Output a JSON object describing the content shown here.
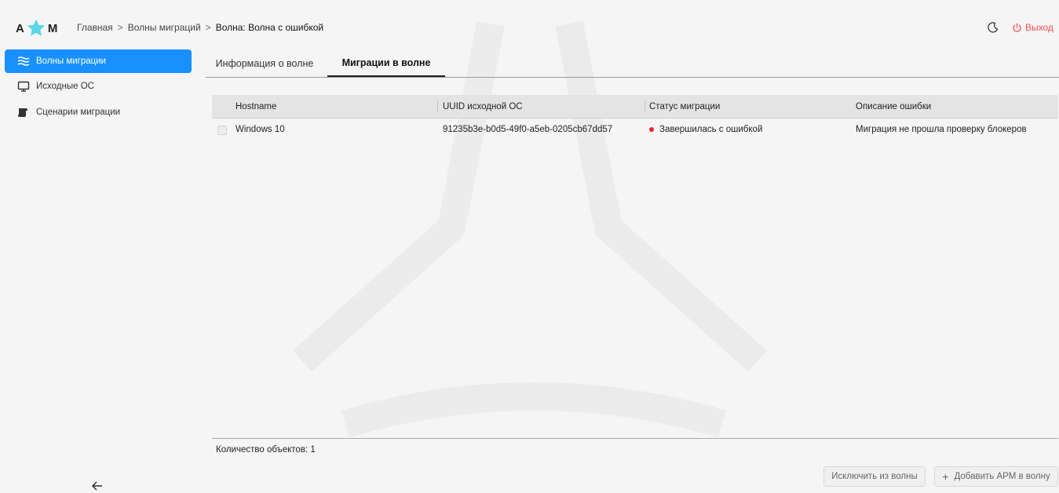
{
  "logo": {
    "left_letter": "A",
    "right_letter": "M",
    "star_color": "#5ad6e8"
  },
  "breadcrumb": [
    {
      "label": "Главная"
    },
    {
      "label": "Волны миграций"
    },
    {
      "label": "Волна: Волна с ошибкой"
    }
  ],
  "breadcrumb_separator": ">",
  "header": {
    "logout_label": "Выход",
    "logout_color": "#ff4d4f"
  },
  "sidebar": {
    "items": [
      {
        "label": "Волны миграции",
        "icon": "waves-icon",
        "active": true
      },
      {
        "label": "Исходные ОС",
        "icon": "monitor-icon",
        "active": false
      },
      {
        "label": "Сценарии миграции",
        "icon": "scroll-icon",
        "active": false
      }
    ],
    "accent": "#1890ff"
  },
  "tabs": [
    {
      "label": "Информация о волне",
      "active": false
    },
    {
      "label": "Миграции в волне",
      "active": true
    }
  ],
  "table": {
    "columns": [
      "Hostname",
      "UUID исходной ОС",
      "Статус миграции",
      "Описание ошибки"
    ],
    "rows": [
      {
        "hostname": "Windows 10",
        "uuid": "91235b3e-b0d5-49f0-a5eb-0205cb67dd57",
        "status": "Завершилась с ошибкой",
        "status_color": "#f5222d",
        "error": "Миграция не прошла проверку блокеров"
      }
    ]
  },
  "footer": {
    "count_label": "Количество объектов: 1",
    "exclude_button": "Исключить из волны",
    "add_button": "Добавить АРМ в волну",
    "add_icon": "+"
  }
}
